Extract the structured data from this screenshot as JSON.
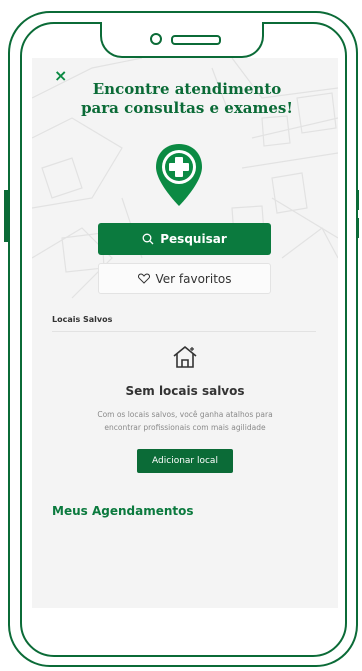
{
  "screen": {
    "title": "Encontre atendimento para consultas e exames!",
    "close_label": "×"
  },
  "actions": {
    "search_label": "Pesquisar",
    "favorites_label": "Ver favoritos"
  },
  "saved_places": {
    "section_label": "Locais Salvos",
    "empty_title": "Sem locais salvos",
    "empty_description": "Com os locais salvos, você ganha atalhos para encontrar profissionais com mais agilidade",
    "add_label": "Adicionar local"
  },
  "appointments": {
    "label": "Meus Agendamentos"
  },
  "icons": {
    "close": "close-icon",
    "pin": "location-pin-plus-icon",
    "search": "search-icon",
    "heart": "heart-icon",
    "house": "house-icon"
  },
  "colors": {
    "brand_green": "#0b7a3e",
    "dark_green": "#0b6b37",
    "background": "#f4f4f4"
  }
}
